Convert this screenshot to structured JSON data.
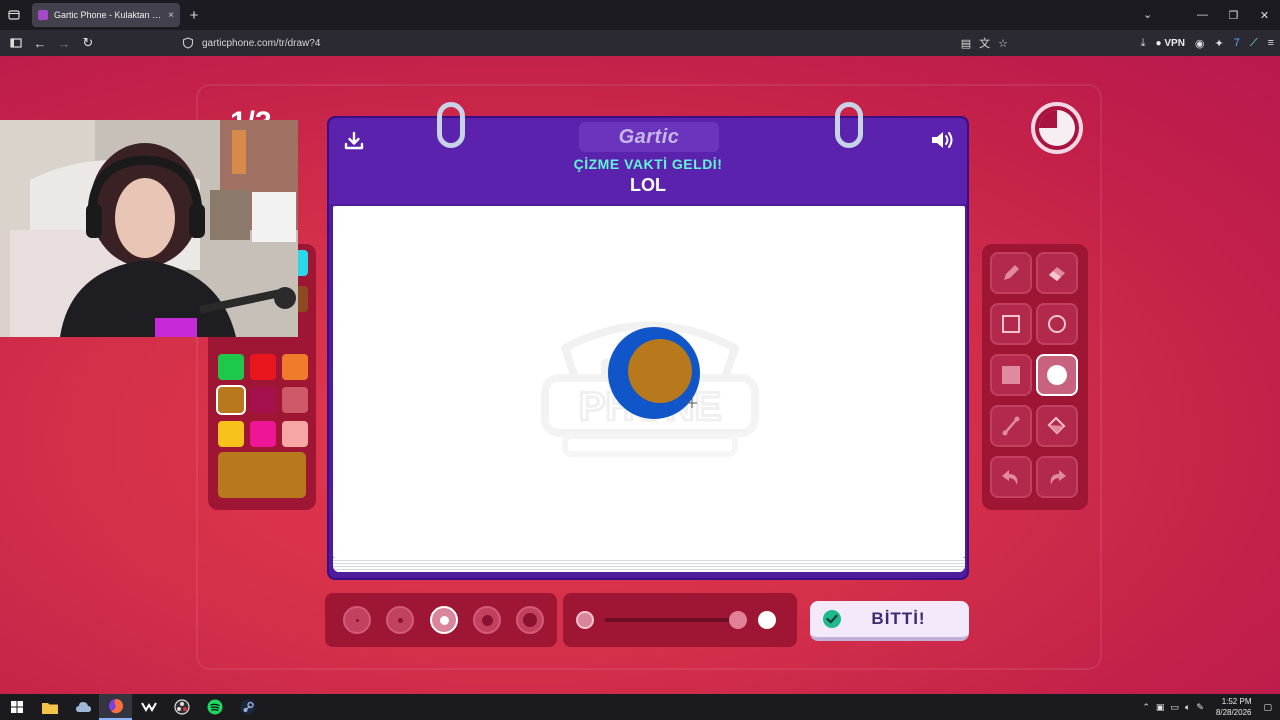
{
  "browser": {
    "tab_title": "Gartic Phone - Kulaktan Kulağa",
    "tab_close": "×",
    "new_tab": "+",
    "url": "garticphone.com/tr/draw?4",
    "vpn_label": "VPN"
  },
  "game": {
    "round_counter": "1/3",
    "logo": "Gartic",
    "headline": "ÇİZME VAKTİ GELDİ!",
    "word": "LOL",
    "done_label": "BİTTİ!",
    "selected_color": "#b8791d",
    "timer_remaining_fraction": 0.75,
    "palette": [
      {
        "name": "green",
        "color": "#1dc84b"
      },
      {
        "name": "red",
        "color": "#e8161e"
      },
      {
        "name": "orange",
        "color": "#f07b2a"
      },
      {
        "name": "brown",
        "color": "#b8791d"
      },
      {
        "name": "maroon",
        "color": "#a5114d"
      },
      {
        "name": "rose",
        "color": "#cf5869"
      },
      {
        "name": "yellow",
        "color": "#f7c21b"
      },
      {
        "name": "pink",
        "color": "#ee1697"
      },
      {
        "name": "light-pink",
        "color": "#f6a6a4"
      }
    ],
    "tools": [
      "pencil",
      "eraser",
      "rectangle",
      "ellipse",
      "filled-rectangle",
      "filled-ellipse",
      "line",
      "fill-bucket",
      "undo",
      "redo"
    ],
    "selected_tool": "filled-ellipse",
    "brush_sizes": 5,
    "selected_brush_size": 3,
    "drawing": {
      "outer_color": "#1056c9",
      "inner_color": "#b8791d"
    }
  },
  "taskbar": {
    "time": "1:52 PM",
    "date": "8/28/2026"
  }
}
